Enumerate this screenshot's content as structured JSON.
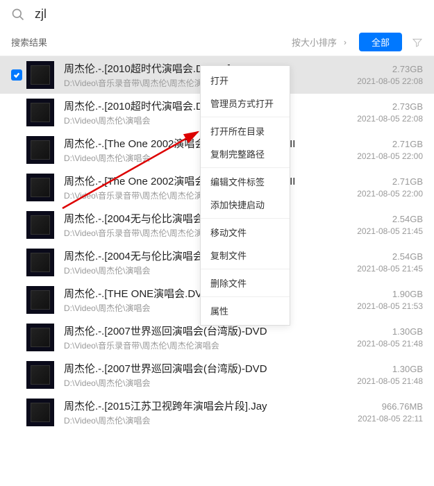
{
  "search": {
    "value": "zjl"
  },
  "toolbar": {
    "results_label": "搜索结果",
    "sort_label": "按大小排序",
    "all_label": "全部"
  },
  "context_menu": {
    "groups": [
      [
        "打开",
        "管理员方式打开"
      ],
      [
        "打开所在目录",
        "复制完整路径"
      ],
      [
        "编辑文件标签",
        "添加快捷启动"
      ],
      [
        "移动文件",
        "复制文件"
      ],
      [
        "删除文件"
      ],
      [
        "属性"
      ]
    ]
  },
  "results": [
    {
      "title": "周杰伦.-.[2010超时代演唱会.DBRIP]-LOADI",
      "path": "D:\\Video\\音乐录音带\\周杰伦\\周杰伦演唱会",
      "size": "2.73GB",
      "date": "2021-08-05 22:08",
      "selected": true
    },
    {
      "title": "周杰伦.-.[2010超时代演唱会.DVDRIP]-LOADI",
      "path": "D:\\Video\\周杰伦\\演唱会",
      "size": "2.73GB",
      "date": "2021-08-05 22:08",
      "selected": false
    },
    {
      "title": "周杰伦.-.[The One 2002演唱会.DVDRIP]-LOADRII",
      "path": "D:\\Video\\周杰伦\\演唱会",
      "size": "2.71GB",
      "date": "2021-08-05 22:00",
      "selected": false
    },
    {
      "title": "周杰伦.-.[The One 2002演唱会.DVDRIP]-LOADRII",
      "path": "D:\\Video\\音乐录音带\\周杰伦\\周杰伦演唱会",
      "size": "2.71GB",
      "date": "2021-08-05 22:00",
      "selected": false
    },
    {
      "title": "周杰伦.-.[2004无与伦比演唱会.DVDRIP]-LC",
      "path": "D:\\Video\\音乐录音带\\周杰伦\\周杰伦演唱会",
      "size": "2.54GB",
      "date": "2021-08-05 21:45",
      "selected": false
    },
    {
      "title": "周杰伦.-.[2004无与伦比演唱会.DVDRIP]-LC",
      "path": "D:\\Video\\周杰伦\\演唱会",
      "size": "2.54GB",
      "date": "2021-08-05 21:45",
      "selected": false
    },
    {
      "title": "周杰伦.-.[THE ONE演唱会.DVDRIP]-LOADI",
      "path": "D:\\Video\\周杰伦\\演唱会",
      "size": "1.90GB",
      "date": "2021-08-05 21:53",
      "selected": false
    },
    {
      "title": "周杰伦.-.[2007世界巡回演唱会(台湾版)-DVD",
      "path": "D:\\Video\\音乐录音带\\周杰伦\\周杰伦演唱会",
      "size": "1.30GB",
      "date": "2021-08-05 21:48",
      "selected": false
    },
    {
      "title": "周杰伦.-.[2007世界巡回演唱会(台湾版)-DVD",
      "path": "D:\\Video\\周杰伦\\演唱会",
      "size": "1.30GB",
      "date": "2021-08-05 21:48",
      "selected": false
    },
    {
      "title": "周杰伦.-.[2015江苏卫视跨年演唱会片段].Jay",
      "path": "D:\\Video\\周杰伦\\演唱会",
      "size": "966.76MB",
      "date": "2021-08-05 22:11",
      "selected": false
    }
  ]
}
